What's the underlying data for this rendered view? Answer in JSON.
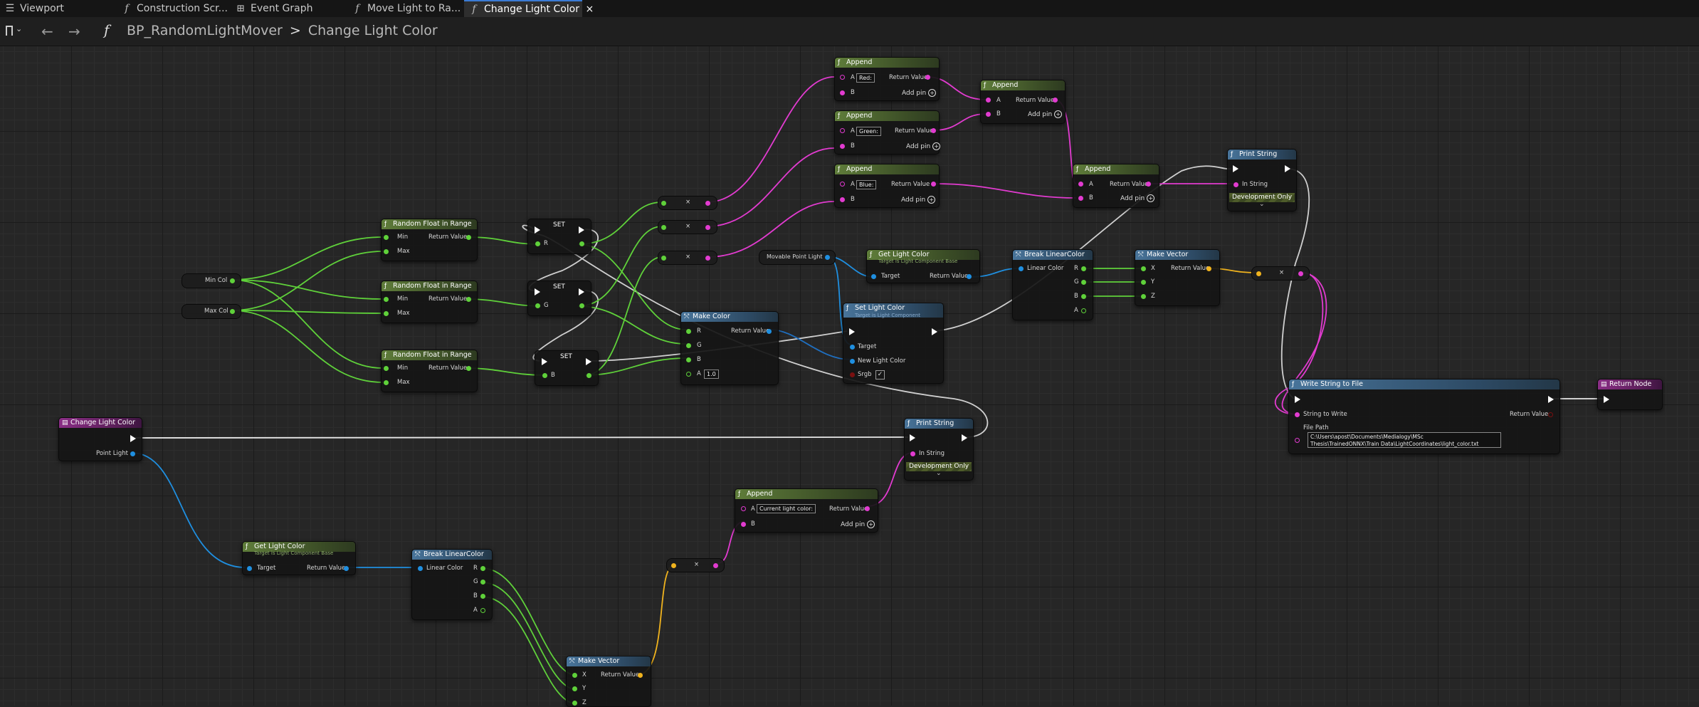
{
  "tabs": [
    {
      "label": "Viewport",
      "icon": "viewport-icon"
    },
    {
      "label": "Construction Scr...",
      "icon": "function-icon"
    },
    {
      "label": "Event Graph",
      "icon": "graph-icon"
    },
    {
      "label": "Move Light to Ra...",
      "icon": "function-icon"
    },
    {
      "label": "Change Light Color",
      "icon": "function-icon",
      "close": "×"
    }
  ],
  "breadcrumb": {
    "blueprint": "BP_RandomLightMover",
    "separator": ">",
    "function": "Change Light Color"
  },
  "toolbar": {
    "back": "←",
    "forward": "→",
    "func_glyph": "f"
  },
  "nodes": {
    "min_col": "Min Col",
    "max_col": "Max Col",
    "rfr_title": "Random Float in Range",
    "min": "Min",
    "max": "Max",
    "return_value": "Return Value",
    "set": "SET",
    "r": "R",
    "g": "G",
    "b": "B",
    "a": "A",
    "x": "X",
    "y": "Y",
    "z": "Z",
    "times": "×",
    "append": "Append",
    "add_pin": "Add pin",
    "red_field": "Red:",
    "green_field": "Green:",
    "blue_field": "Blue:",
    "make_color": "Make Color",
    "alpha_value": "1.0",
    "movable_point_light": "Movable Point Light",
    "get_light_color": "Get Light Color",
    "target_light_component": "Target is Light Component Base",
    "target": "Target",
    "set_light_color": "Set Light Color",
    "target_light_component2": "Target is Light Component",
    "new_light_color": "New Light Color",
    "srgb": "Srgb",
    "break_linear_color": "Break LinearColor",
    "linear_color": "Linear Color",
    "make_vector": "Make Vector",
    "print_string": "Print String",
    "in_string": "In String",
    "development_only": "Development Only",
    "write_string_to_file": "Write String to File",
    "string_to_write": "String to Write",
    "file_path_label": "File Path",
    "file_path_line1": "C:\\Users\\apost\\Documents\\Medialogy\\MSc",
    "file_path_line2": "Thesis\\TrainedONNX\\Train Data\\LightCoordinates\\light_color.txt",
    "return_node": "Return Node",
    "change_light_color": "Change Light Color",
    "point_light": "Point Light",
    "current_light_color": "Current light color: ",
    "chevron": "⌄",
    "checkmark": "✓"
  },
  "colors": {
    "exec": "#ffffff",
    "float": "#5fd13a",
    "string": "#e23bd0",
    "object": "#1f8fe0",
    "struct_vector": "#f0b31e",
    "struct_color": "#1f6fc0",
    "tab_active": "#3a7bd5"
  }
}
